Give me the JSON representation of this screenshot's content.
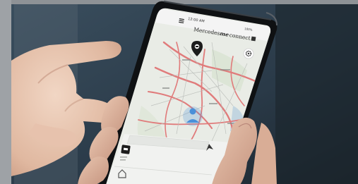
{
  "status_bar": {
    "time": "12:00 AM",
    "battery": "100%"
  },
  "app": {
    "brand": "Mercedes",
    "logo_word": "me",
    "suffix": "connect"
  },
  "colors": {
    "frame_top": "#8e9296",
    "frame_left": "#9ea2a6",
    "background": "#26323c",
    "map_land": "#e9ece6",
    "map_road": "#e07b7b",
    "map_water": "#a9c7dc",
    "location_blue": "#4a90d9",
    "phone_body": "#0f1113"
  },
  "icons": [
    "menu-icon",
    "vehicle-pin-icon",
    "gear-icon",
    "location-dot-icon",
    "car-status-icon",
    "home-icon",
    "navigate-icon"
  ]
}
